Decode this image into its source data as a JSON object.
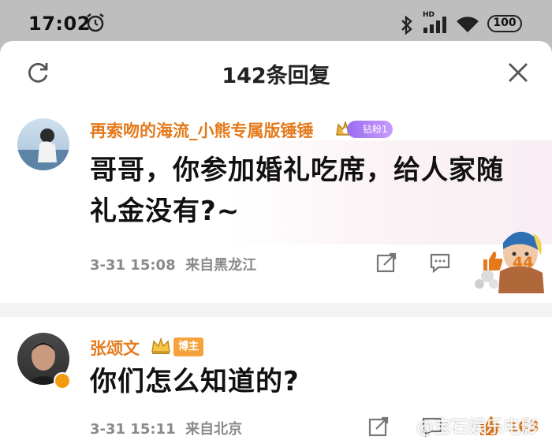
{
  "status_bar": {
    "time": "17:02",
    "network_label": "HD",
    "battery": "100",
    "icons": [
      "alarm-icon",
      "bluetooth-icon",
      "signal-icon",
      "wifi-icon",
      "battery-icon"
    ]
  },
  "sheet": {
    "title": "142条回复",
    "icons": [
      "refresh-icon",
      "close-icon"
    ]
  },
  "comments": [
    {
      "username": "再索吻的海流_小熊专属版锤锤",
      "badge": "钻粉1",
      "content": "哥哥，你参加婚礼吃席，给人家随礼金没有?~",
      "date": "3-31 15:08",
      "location": "来自黑龙江",
      "likes": "44"
    },
    {
      "username": "张颂文",
      "badge": "博主",
      "content": "你们怎么知道的?",
      "date": "3-31 15:11",
      "location": "来自北京",
      "likes": "163"
    }
  ],
  "watermark": "@宝石娱乐电影",
  "colors": {
    "username": "#e47a1c",
    "like_active": "#e47a1c",
    "meta": "#8a8a8a",
    "fan_badge": "#9b6df2",
    "host_badge": "#f5a23c"
  }
}
